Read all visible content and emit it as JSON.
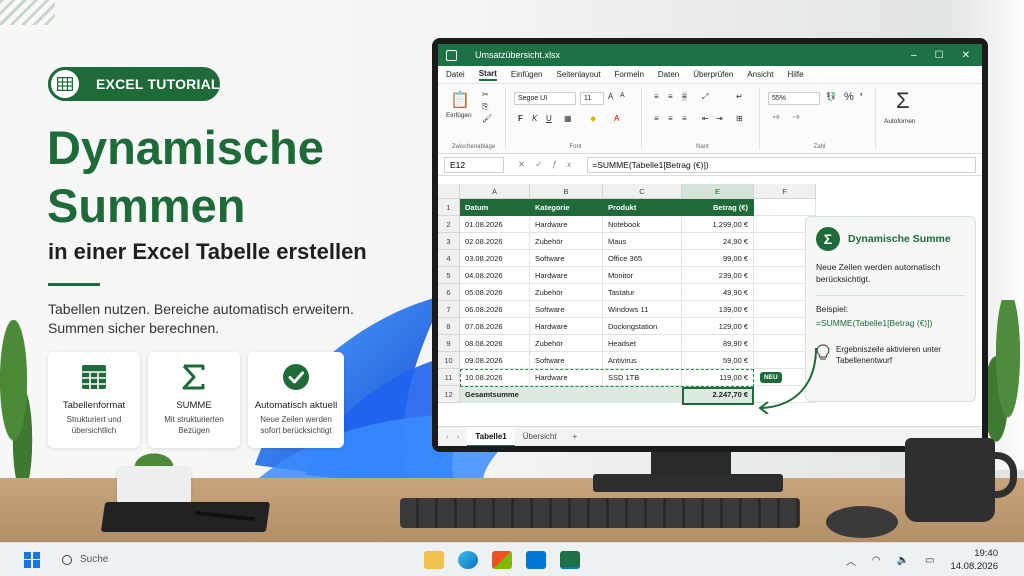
{
  "hero": {
    "badge": "EXCEL TUTORIAL",
    "title_line1": "Dynamische",
    "title_line2": "Summen",
    "subtitle": "in einer Excel Tabelle erstellen",
    "intro": "Tabellen nutzen. Bereiche automatisch erweitern. Summen sicher berechnen."
  },
  "features": [
    {
      "title": "Tabellenformat",
      "desc": "Strukturiert und übersichtlich",
      "icon": "table-icon"
    },
    {
      "title": "SUMME",
      "desc": "Mit strukturierten Bezügen",
      "icon": "sigma-icon"
    },
    {
      "title": "Automatisch aktuell",
      "desc": "Neue Zeilen werden sofort berücksichtigt",
      "icon": "check-icon"
    }
  ],
  "excel": {
    "filename": "Umsatzübersicht.xlsx",
    "menu": [
      "Datei",
      "Start",
      "Einfügen",
      "Seitenlayout",
      "Formeln",
      "Daten",
      "Überprüfen",
      "Ansicht",
      "Hilfe"
    ],
    "ribbon": {
      "paste": "Einfügen",
      "clipboard": "Zwischenablage",
      "font_name": "Segoe UI",
      "font_size": "11",
      "font_group": "Font",
      "align_group": "Nant",
      "number_format": "55%",
      "number_group": "Zahl",
      "autosum": "Autofomen"
    },
    "name_box": "E12",
    "formula": "=SUMME(Tabelle1[Betrag (€)])",
    "columns": [
      "A",
      "B",
      "C",
      "E",
      "F"
    ],
    "headers": [
      "Datum",
      "Kategorie",
      "Produkt",
      "Betrag (€)"
    ],
    "rows": [
      [
        "01.08.2026",
        "Hardware",
        "Notebook",
        "1.299,00 €"
      ],
      [
        "02.08.2026",
        "Zubehör",
        "Maus",
        "24,90 €"
      ],
      [
        "03.08.2026",
        "Software",
        "Office 365",
        "99,00 €"
      ],
      [
        "04.08.2026",
        "Hardware",
        "Monitor",
        "239,00 €"
      ],
      [
        "05.08.2026",
        "Zubehör",
        "Tastatur",
        "49,90 €"
      ],
      [
        "06.08.2026",
        "Software",
        "Windows 11",
        "139,00 €"
      ],
      [
        "07.08.2026",
        "Hardware",
        "Dockingstation",
        "129,00 €"
      ],
      [
        "08.08.2026",
        "Zubehör",
        "Headset",
        "89,90 €"
      ],
      [
        "09.08.2026",
        "Software",
        "Antivirus",
        "59,00 €"
      ],
      [
        "10.08.2026",
        "Hardware",
        "SSD 1TB",
        "119,00 €"
      ]
    ],
    "total_label": "Gesamtsumme",
    "total_value": "2.247,70 €",
    "new_badge": "NEU",
    "sheets": [
      "Tabelle1",
      "Übersicht"
    ],
    "plus": "+"
  },
  "info": {
    "title": "Dynamische Summe",
    "text": "Neue Zeilen werden automatisch berücksichtigt.",
    "example_label": "Beispiel:",
    "example_formula": "=SUMME(Tabelle1[Betrag (€)])",
    "tip": "Ergebniszeile aktivieren unter Tabellenentwurf"
  },
  "taskbar": {
    "search": "Suche",
    "time": "19:40",
    "date": "14.08.2026"
  },
  "colors": {
    "accent": "#1e6b39",
    "excel_green": "#1e7145",
    "total_fill": "#dcebdf"
  }
}
